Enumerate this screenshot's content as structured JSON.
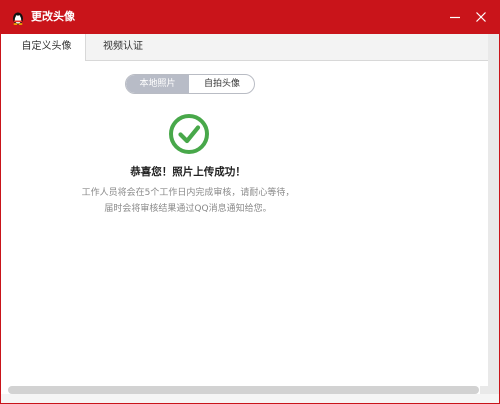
{
  "window": {
    "title": "更改头像",
    "app_icon": "penguin-icon"
  },
  "tabs": [
    {
      "label": "自定义头像",
      "active": true
    },
    {
      "label": "视频认证",
      "active": false
    }
  ],
  "toggle": {
    "left_label": "本地照片",
    "right_label": "自拍头像",
    "selected": "本地照片"
  },
  "result": {
    "icon": "check-circle-icon",
    "title": "恭喜您！照片上传成功！",
    "description_line1": "工作人员将会在5个工作日内完成审核，请耐心等待，",
    "description_line2": "届时会将审核结果通过QQ消息通知给您。"
  },
  "colors": {
    "titlebar": "#c9141a",
    "success_green": "#48a84a",
    "toggle_selected": "#b8bcc7"
  }
}
